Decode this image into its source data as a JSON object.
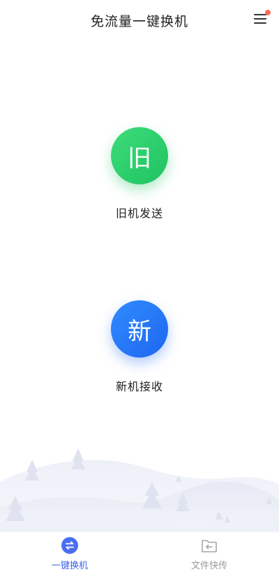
{
  "header": {
    "title": "免流量一键换机",
    "menu_icon": "menu-icon",
    "notification_color": "#ff6b57"
  },
  "actions": {
    "old_phone": {
      "circle_text": "旧",
      "label": "旧机发送",
      "color": "#22c868"
    },
    "new_phone": {
      "circle_text": "新",
      "label": "新机接收",
      "color": "#2a78f5"
    }
  },
  "bottom_nav": {
    "items": [
      {
        "label": "一键换机",
        "icon": "switch-arrows-icon",
        "active": true,
        "color": "#3a63e8"
      },
      {
        "label": "文件快传",
        "icon": "file-transfer-icon",
        "active": false,
        "color": "#9a9a9a"
      }
    ]
  }
}
